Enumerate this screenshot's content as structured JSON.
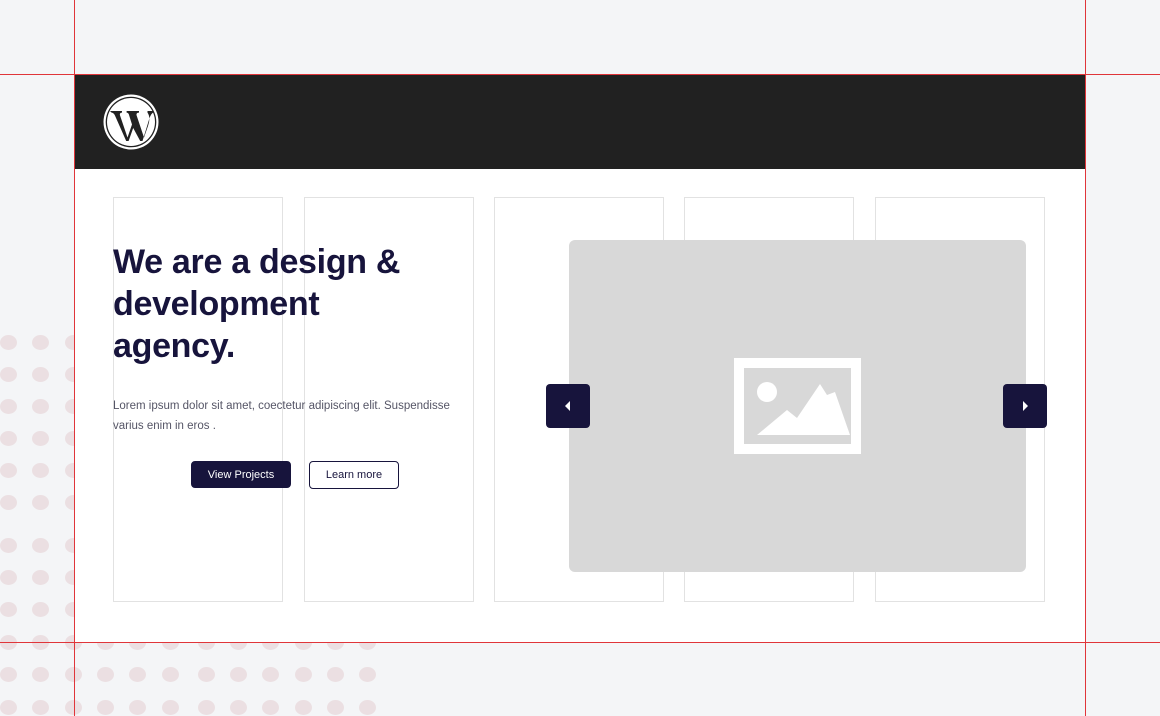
{
  "header": {
    "logo_icon": "wordpress-logo-icon",
    "background_color": "#212121"
  },
  "hero": {
    "title": "We are a design & development agency.",
    "description": "Lorem ipsum dolor sit amet, coectetur adipiscing elit. Suspendisse varius enim in eros .",
    "primary_button": "View Projects",
    "secondary_button": "Learn more",
    "accent_color": "#17143c"
  },
  "slider": {
    "image_icon": "image-placeholder-icon",
    "prev_icon": "caret-left-icon",
    "next_icon": "caret-right-icon"
  },
  "guides": {
    "color": "#e0353a"
  }
}
